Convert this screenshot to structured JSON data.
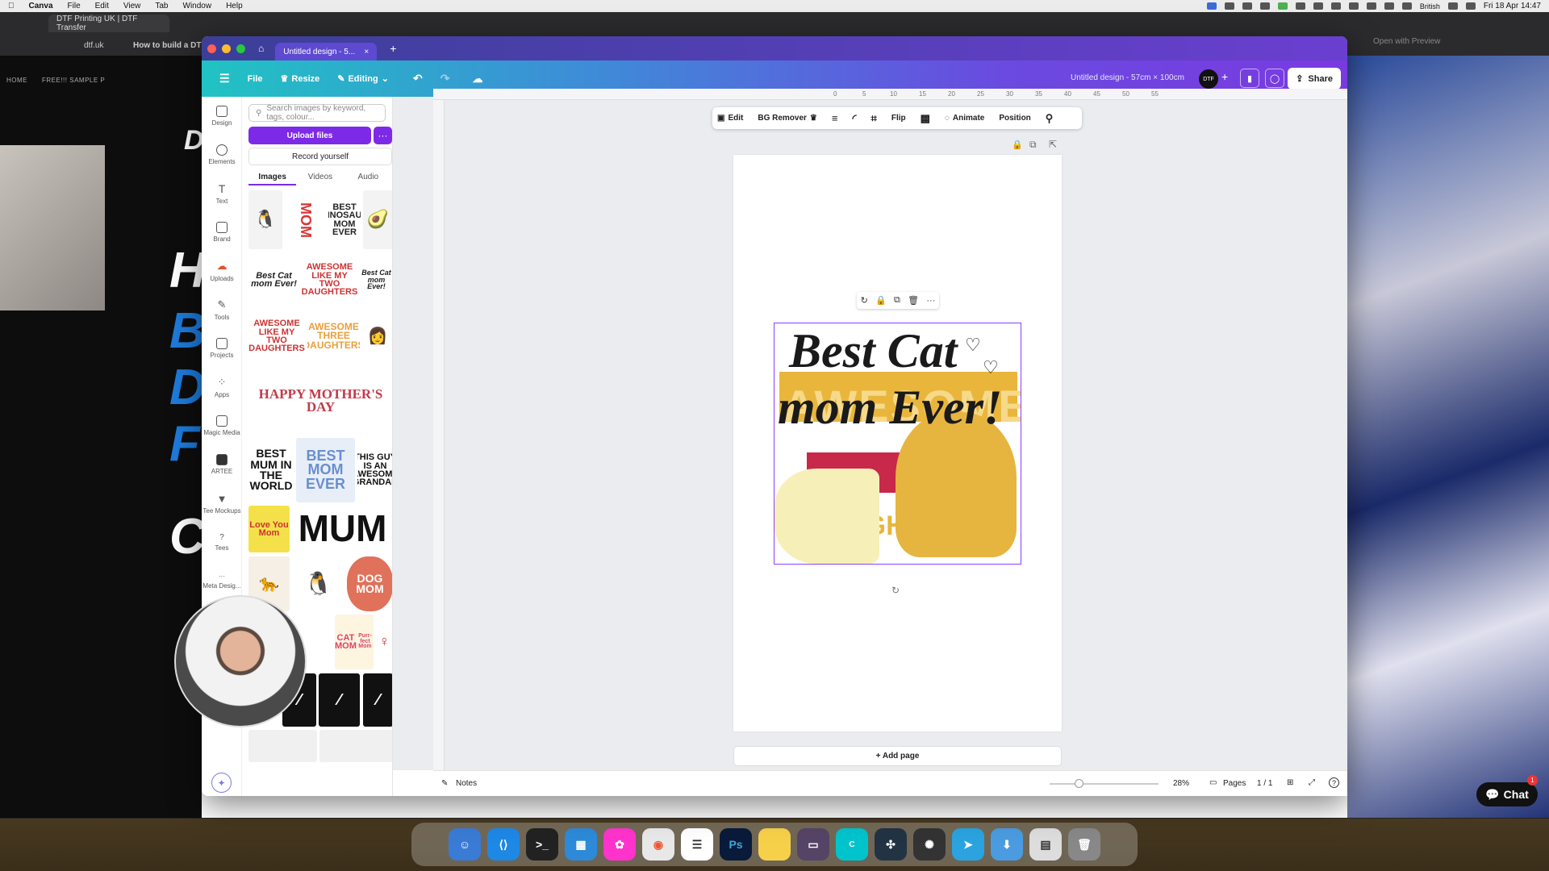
{
  "menubar": {
    "app": "Canva",
    "items": [
      "File",
      "Edit",
      "View",
      "Tab",
      "Window",
      "Help"
    ],
    "language": "British",
    "clock": "Fri 18 Apr 14:47"
  },
  "browser": {
    "tab1": "DTF Printing UK | DTF Transfer",
    "tab2": "How to build a DTF",
    "address": "dtf.uk",
    "right_label": "Open with Preview"
  },
  "website": {
    "nav": [
      "HOME",
      "FREE!!! SAMPLE P"
    ],
    "letters": [
      "D",
      "H",
      "B",
      "D",
      "F",
      "C"
    ]
  },
  "canva": {
    "tab_title": "Untitled design - 5...",
    "toolbar": {
      "file": "File",
      "resize": "Resize",
      "editing": "Editing",
      "doc_title": "Untitled design - 57cm × 100cm",
      "avatar": "DTF",
      "share": "Share"
    },
    "rail": [
      "Design",
      "Elements",
      "Text",
      "Brand",
      "Uploads",
      "Tools",
      "Projects",
      "Apps",
      "Magic Media",
      "ARTEE",
      "Tee Mockups",
      "Tees",
      "Meta Desig..."
    ],
    "panel": {
      "search_placeholder": "Search images by keyword, tags, colour...",
      "upload": "Upload files",
      "record": "Record yourself",
      "tabs": [
        "Images",
        "Videos",
        "Audio"
      ]
    },
    "thumbs": {
      "mom_words": "MOM",
      "best_dino": "BEST DINOSAUR MOM EVER",
      "cat_mom": "Best Cat mom Ever!",
      "awesome": "AWESOME LIKE MY TWO DAUGHTERS",
      "awesome3": "AWESOME THREE DAUGHTERS",
      "mothers_day": "HAPPY MOTHER'S DAY",
      "best_mum": "BEST MUM IN THE WORLD",
      "best_mom": "BEST MOM EVER",
      "this_guy": "THIS GUY IS AN AWESOME GRANDAD",
      "love_you": "Love You Mom",
      "mum": "MUM",
      "dog_mom": "DOG MOM",
      "cat_mom2": "CAT MOM",
      "purrfect": "Purr-fect Mom"
    },
    "ruler_ticks": [
      "0",
      "5",
      "10",
      "15",
      "20",
      "25",
      "30",
      "35",
      "40",
      "45",
      "50",
      "55"
    ],
    "context": [
      "Edit",
      "BG Remover",
      "Flip",
      "Animate",
      "Position"
    ],
    "design": {
      "line1": "Best Cat",
      "line2": "mom Ever!",
      "bg_word": "AWESOME",
      "bg_word2": "DAUGH"
    },
    "add_page": "+ Add page",
    "bottom": {
      "notes": "Notes",
      "zoom": "28%",
      "pages": "Pages",
      "page_count": "1 / 1"
    }
  },
  "chat": {
    "label": "Chat",
    "badge": "1"
  },
  "colors": {
    "accent": "#7d2ae8",
    "selection": "#8b3dff",
    "design_yellow": "#e9b63b"
  }
}
